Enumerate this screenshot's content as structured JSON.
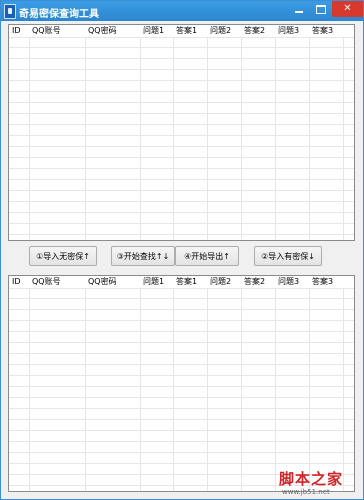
{
  "window": {
    "title": "奇易密保查询工具"
  },
  "controls": {
    "close_glyph": "✕"
  },
  "top_table": {
    "columns": [
      "ID",
      "QQ账号",
      "QQ密码",
      "问题1",
      "答案1",
      "问题2",
      "答案2",
      "问题3",
      "答案3"
    ]
  },
  "bottom_table": {
    "columns": [
      "ID",
      "QQ账号",
      "QQ密码",
      "问题1",
      "答案1",
      "问题2",
      "答案2",
      "问题3",
      "答案3"
    ]
  },
  "buttons": {
    "import_no_protect": "①导入无密保↑",
    "start_query": "③开始查找↑↓",
    "start_export": "④开始导出↑",
    "import_with_protect": "②导入有密保↓"
  },
  "watermark": {
    "logo": "脚本之家",
    "url": "www.jb51.net"
  }
}
